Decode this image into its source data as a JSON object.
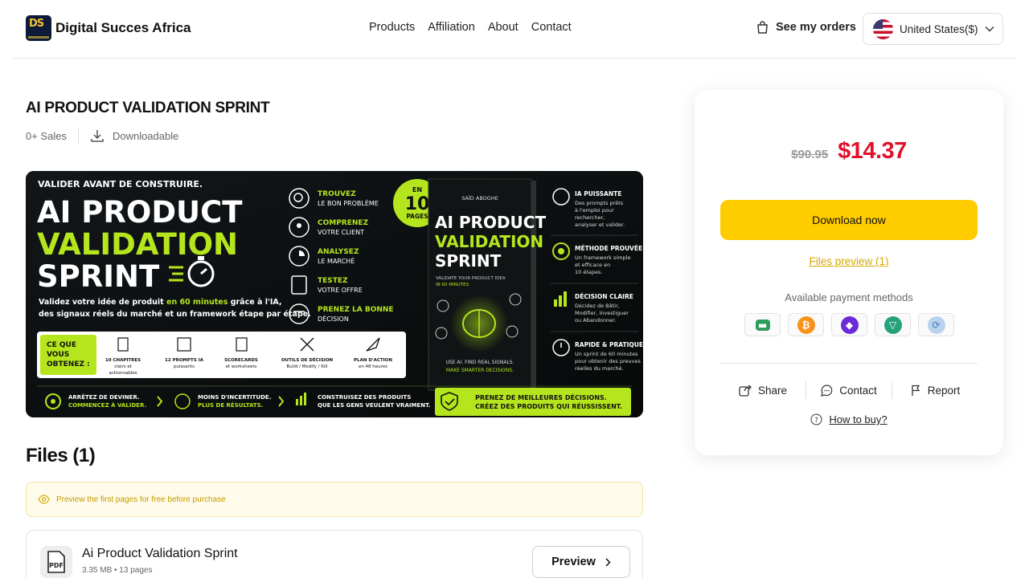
{
  "header": {
    "brand": "Digital Succes Africa",
    "logo_text": "DS",
    "nav": [
      "Products",
      "Affiliation",
      "About",
      "Contact"
    ],
    "orders_label": "See my orders",
    "country_label": "United States($)"
  },
  "product": {
    "title": "AI PRODUCT VALIDATION SPRINT",
    "sales": "0+ Sales",
    "type": "Downloadable"
  },
  "banner": {
    "kicker": "VALIDER AVANT DE CONSTRUIRE.",
    "line1": "AI PRODUCT",
    "line2": "VALIDATION",
    "line3": "SPRINT",
    "desc1_a": "Validez votre idée de produit ",
    "desc1_b": "en 60 minutes",
    "desc1_c": " grâce à l'IA,",
    "desc2": "des signaux réels du marché et un framework étape par étape.",
    "steps": [
      {
        "t": "TROUVEZ",
        "s": "LE BON PROBLÈME"
      },
      {
        "t": "COMPRENEZ",
        "s": "VOTRE CLIENT"
      },
      {
        "t": "ANALYSEZ",
        "s": "LE MARCHÉ"
      },
      {
        "t": "TESTEZ",
        "s": "VOTRE OFFRE"
      },
      {
        "t": "PRENEZ LA BONNE",
        "s": "DÉCISION"
      }
    ],
    "badge": [
      "EN",
      "10",
      "PAGES"
    ],
    "book_author": "SAÏD ABOGHE",
    "book_t1": "AI PRODUCT",
    "book_t2": "VALIDATION",
    "book_t3": "SPRINT",
    "book_sub1": "VALIDATE YOUR PRODUCT IDEA",
    "book_sub2": "IN 60 MINUTES",
    "book_foot1": "USE AI. FIND REAL SIGNALS.",
    "book_foot2": "MAKE SMARTER DECISIONS.",
    "features": [
      {
        "t": "IA PUISSANTE",
        "d": [
          "Des prompts prêts",
          "à l'emploi pour",
          "rechercher,",
          "analyser et valider."
        ]
      },
      {
        "t": "MÉTHODE PROUVÉE",
        "d": [
          "Un framework simple",
          "et efficace en",
          "10 étapes."
        ]
      },
      {
        "t": "DÉCISION CLAIRE",
        "d": [
          "Décidez de Bâtir,",
          "Modifier, Investiguer",
          "ou Abandonner."
        ]
      },
      {
        "t": "RAPIDE & PRATIQUE",
        "d": [
          "Un sprint de 60 minutes",
          "pour obtenir des preuves",
          "réelles du marché."
        ]
      }
    ],
    "get_label": [
      "CE QUE",
      "VOUS",
      "OBTENEZ :"
    ],
    "get_items": [
      {
        "t": "10 CHAPITRES",
        "s": "clairs et",
        "s2": "actionnables"
      },
      {
        "t": "12 PROMPTS IA",
        "s": "puissants",
        "s2": ""
      },
      {
        "t": "SCORECARDS",
        "s": "et worksheets",
        "s2": ""
      },
      {
        "t": "OUTILS DE DÉCISION",
        "s": "Build / Modify / Kill",
        "s2": ""
      },
      {
        "t": "PLAN D'ACTION",
        "s": "en 48 heures",
        "s2": ""
      }
    ],
    "bottom": [
      {
        "a": "ARRÊTEZ DE DEVINER.",
        "b": "COMMENCEZ À VALIDER."
      },
      {
        "a": "MOINS D'INCERTITUDE.",
        "b": "PLUS DE RÉSULTATS."
      },
      {
        "a": "CONSTRUISEZ DES PRODUITS",
        "b": "QUE LES GENS VEULENT VRAIMENT."
      }
    ],
    "cta1": "PRENEZ DE MEILLEURES DÉCISIONS.",
    "cta2": "CRÉEZ DES PRODUITS QUI RÉUSSISSENT."
  },
  "files": {
    "heading": "Files (1)",
    "notice": "Preview the first pages for free before purchase",
    "items": [
      {
        "name": "Ai Product Validation Sprint",
        "meta": "3.35 MB • 13 pages",
        "icon_label": "PDF",
        "preview_label": "Preview"
      }
    ]
  },
  "purchase": {
    "old_price": "$90.95",
    "price": "$14.37",
    "download_label": "Download now",
    "files_preview": "Files preview (1)",
    "payment_label": "Available payment methods",
    "payment_methods": [
      "card-icon",
      "bitcoin-icon",
      "ethereum-icon",
      "tether-icon",
      "stablecoin-icon"
    ],
    "share": "Share",
    "contact": "Contact",
    "report": "Report",
    "how_to_buy": "How to buy?"
  },
  "colors": {
    "accent_yellow": "#ffcc00",
    "price_red": "#e0112b",
    "banner_green": "#b5e61d"
  }
}
